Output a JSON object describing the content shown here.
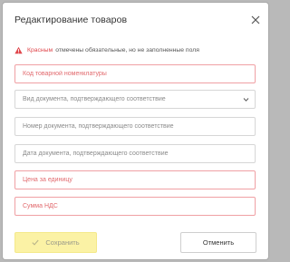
{
  "dialog": {
    "title": "Редактирование товаров",
    "close_icon": "close-icon"
  },
  "notice": {
    "icon": "warning-icon",
    "highlight": "Красным",
    "text": "отмечены обязательные, но не заполненные поля"
  },
  "fields": [
    {
      "placeholder": "Код товарной номенклатуры",
      "value": "",
      "required": true
    },
    {
      "placeholder": "Вид документа, подтверждающего соответствие",
      "value": "",
      "type": "select",
      "icon": "chevron-down-icon"
    },
    {
      "placeholder": "Номер документа, подтверждающего соответствие",
      "value": ""
    },
    {
      "placeholder": "Дата документа, подтверждающего соответствие",
      "value": ""
    },
    {
      "placeholder": "Цена за единицу",
      "value": "",
      "required": true
    },
    {
      "placeholder": "Сумма НДС",
      "value": "",
      "required": true
    }
  ],
  "buttons": {
    "save_label": "Сохранить",
    "save_icon": "check-icon",
    "cancel_label": "Отменить"
  },
  "colors": {
    "required": "#e0474c",
    "save_bg": "#fbf2a5"
  }
}
